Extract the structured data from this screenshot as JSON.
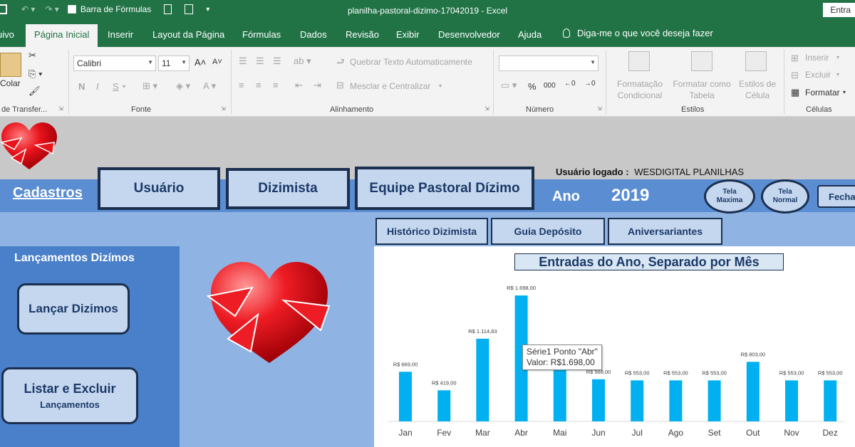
{
  "titlebar": {
    "formula_bar_label": "Barra de Fórmulas",
    "title": "planilha-pastoral-dizimo-17042019  -  Excel",
    "signin": "Entra",
    "bg": "#217346"
  },
  "tabs": {
    "items": [
      "uivo",
      "Página Inicial",
      "Inserir",
      "Layout da Página",
      "Fórmulas",
      "Dados",
      "Revisão",
      "Exibir",
      "Desenvolvedor",
      "Ajuda"
    ],
    "tell_me": "Diga-me o que você deseja fazer"
  },
  "ribbon": {
    "clipboard": {
      "paste": "Colar",
      "label": "de Transfer..."
    },
    "font": {
      "name": "Calibri",
      "size": "11",
      "bold": "N",
      "italic": "I",
      "underline": "S",
      "label": "Fonte"
    },
    "alignment": {
      "wrap": "Quebrar Texto Automaticamente",
      "merge": "Mesclar e Centralizar",
      "label": "Alinhamento"
    },
    "number": {
      "format": "",
      "percent": "%",
      "thousands": "000",
      "label": "Número"
    },
    "styles": {
      "conditional": "Formatação Condicional",
      "as_table": "Formatar como Tabela",
      "cell_styles": "Estilos de Célula",
      "label": "Estilos"
    },
    "cells": {
      "insert": "Inserir",
      "delete": "Excluir",
      "format": "Formatar",
      "label": "Células"
    }
  },
  "sheet": {
    "logged_user_label": "Usuário logado :",
    "logged_user": "WESDIGITAL PLANILHAS",
    "cadastros": "Cadastros",
    "nav": {
      "usuario": "Usuário",
      "dizimista": "Dizimista",
      "equipe": "Equipe Pastoral Dízimo"
    },
    "year_label": "Ano",
    "year": "2019",
    "tela_maxima": [
      "Tela",
      "Maxima"
    ],
    "tela_normal": [
      "Tela",
      "Normal"
    ],
    "fechar": "Fecha",
    "sub_nav": {
      "historico": "Histórico Dizimista",
      "guia": "Guia Depósito",
      "aniversariantes": "Aniversariantes"
    },
    "lancamentos_title": "Lançamentos Dizímos",
    "lancar": "Lançar Dizimos",
    "listar": "Listar e Excluir",
    "listar_sub": "Lançamentos"
  },
  "tooltip": {
    "line1": "Série1 Ponto \"Abr\"",
    "line2": "Valor:  R$1.698,00"
  },
  "chart_data": {
    "type": "bar",
    "title": "Entradas do Ano, Separado por Mês",
    "categories": [
      "Jan",
      "Fev",
      "Mar",
      "Abr",
      "Mai",
      "Jun",
      "Jul",
      "Ago",
      "Set",
      "Out",
      "Nov",
      "Dez"
    ],
    "values": [
      669,
      419,
      1114.83,
      1698,
      723,
      568,
      553,
      553,
      553,
      803,
      553,
      553
    ],
    "labels": [
      "R$ 669,00",
      "R$ 419,00",
      "R$ 1.114,83",
      "R$ 1.698,00",
      "",
      "R$ 568,00",
      "R$ 553,00",
      "R$ 553,00",
      "R$ 553,00",
      "R$ 803,00",
      "R$ 553,00",
      "R$ 553,00"
    ],
    "ylim": [
      0,
      1750
    ],
    "color": "#00b0f0",
    "grid": false
  }
}
